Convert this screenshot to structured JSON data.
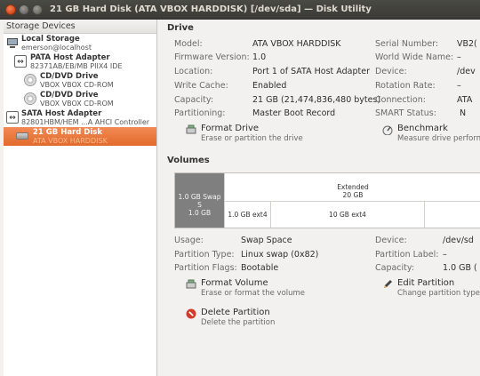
{
  "window": {
    "title": "21 GB Hard Disk (ATA VBOX HARDDISK) [/dev/sda] — Disk Utility"
  },
  "sidebar": {
    "header": "Storage Devices",
    "items": [
      {
        "title": "Local Storage",
        "subtitle": "emerson@localhost",
        "icon": "computer-icon"
      },
      {
        "title": "PATA Host Adapter",
        "subtitle": "82371AB/EB/MB PIIX4 IDE",
        "icon": "adapter-icon"
      },
      {
        "title": "CD/DVD Drive",
        "subtitle": "VBOX VBOX CD-ROM",
        "icon": "optical-disc-icon"
      },
      {
        "title": "CD/DVD Drive",
        "subtitle": "VBOX VBOX CD-ROM",
        "icon": "optical-disc-icon"
      },
      {
        "title": "SATA Host Adapter",
        "subtitle": "82801HBM/HEM ...A AHCI Controller",
        "icon": "adapter-icon"
      },
      {
        "title": "21 GB Hard Disk",
        "subtitle": "ATA VBOX HARDDISK",
        "icon": "hard-disk-icon"
      }
    ]
  },
  "drive": {
    "title": "Drive",
    "left": [
      {
        "label": "Model:",
        "value": "ATA VBOX HARDDISK"
      },
      {
        "label": "Firmware Version:",
        "value": "1.0"
      },
      {
        "label": "Location:",
        "value": "Port 1 of SATA Host Adapter"
      },
      {
        "label": "Write Cache:",
        "value": "Enabled"
      },
      {
        "label": "Capacity:",
        "value": "21 GB (21,474,836,480 bytes)"
      },
      {
        "label": "Partitioning:",
        "value": "Master Boot Record"
      }
    ],
    "right": [
      {
        "label": "Serial Number:",
        "value": "VB2("
      },
      {
        "label": "World Wide Name:",
        "value": "–"
      },
      {
        "label": "Device:",
        "value": "/dev"
      },
      {
        "label": "Rotation Rate:",
        "value": "–"
      },
      {
        "label": "Connection:",
        "value": "ATA"
      },
      {
        "label": "SMART Status:",
        "value": "N"
      }
    ],
    "actions": {
      "format": {
        "title": "Format Drive",
        "desc": "Erase or partition the drive"
      },
      "benchmark": {
        "title": "Benchmark",
        "desc": "Measure drive perform..."
      }
    }
  },
  "volumes": {
    "title": "Volumes",
    "map": {
      "swap": {
        "label": "1.0 GB Swap S",
        "size": "1.0 GB"
      },
      "extended": {
        "label": "Extended",
        "size": "20 GB"
      },
      "ext1": {
        "label": "1.0 GB ext4"
      },
      "ext2": {
        "label": "10 GB ext4"
      }
    },
    "left": [
      {
        "label": "Usage:",
        "value": "Swap Space"
      },
      {
        "label": "Partition Type:",
        "value": "Linux swap (0x82)"
      },
      {
        "label": "Partition Flags:",
        "value": "Bootable"
      }
    ],
    "right": [
      {
        "label": "Device:",
        "value": "/dev/sd"
      },
      {
        "label": "Partition Label:",
        "value": "–"
      },
      {
        "label": "Capacity:",
        "value": "1.0 GB ("
      }
    ],
    "actions": {
      "format": {
        "title": "Format Volume",
        "desc": "Erase or format the volume"
      },
      "edit": {
        "title": "Edit Partition",
        "desc": "Change partition type, l"
      },
      "delete": {
        "title": "Delete Partition",
        "desc": "Delete the partition"
      }
    }
  },
  "colors": {
    "selection": "#e8753d",
    "swap_segment": "#7f7f7f",
    "titlebar": "#3e3d39"
  }
}
